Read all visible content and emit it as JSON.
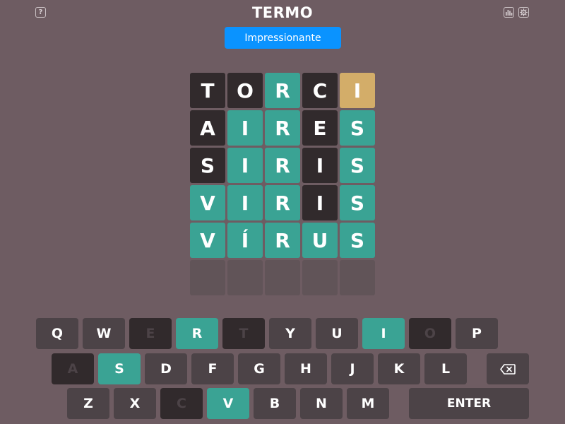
{
  "header": {
    "title": "TERMO",
    "help_label": "?",
    "icons": [
      "question-icon",
      "stats-chart-icon",
      "gear-icon"
    ]
  },
  "toast": {
    "message": "Impressionante"
  },
  "colors": {
    "background": "#6e5c62",
    "correct": "#3aa394",
    "present": "#d3ad69",
    "absent": "#312a2c",
    "empty": "#615458",
    "key": "#4c4347",
    "toast": "#0a93ff"
  },
  "board": {
    "rows": [
      {
        "letters": [
          "T",
          "O",
          "R",
          "C",
          "I"
        ],
        "states": [
          "absent",
          "absent",
          "correct",
          "absent",
          "present"
        ]
      },
      {
        "letters": [
          "A",
          "I",
          "R",
          "E",
          "S"
        ],
        "states": [
          "absent",
          "correct",
          "correct",
          "absent",
          "correct"
        ]
      },
      {
        "letters": [
          "S",
          "I",
          "R",
          "I",
          "S"
        ],
        "states": [
          "absent",
          "correct",
          "correct",
          "absent",
          "correct"
        ]
      },
      {
        "letters": [
          "V",
          "I",
          "R",
          "I",
          "S"
        ],
        "states": [
          "correct",
          "correct",
          "correct",
          "absent",
          "correct"
        ]
      },
      {
        "letters": [
          "V",
          "Í",
          "R",
          "U",
          "S"
        ],
        "states": [
          "correct",
          "correct",
          "correct",
          "correct",
          "correct"
        ]
      },
      {
        "letters": [
          "",
          "",
          "",
          "",
          ""
        ],
        "states": [
          "empty",
          "empty",
          "empty",
          "empty",
          "empty"
        ]
      }
    ]
  },
  "keyboard": {
    "rows": [
      [
        {
          "label": "Q",
          "state": "normal"
        },
        {
          "label": "W",
          "state": "normal"
        },
        {
          "label": "E",
          "state": "absent"
        },
        {
          "label": "R",
          "state": "correct"
        },
        {
          "label": "T",
          "state": "absent"
        },
        {
          "label": "Y",
          "state": "normal"
        },
        {
          "label": "U",
          "state": "normal"
        },
        {
          "label": "I",
          "state": "correct"
        },
        {
          "label": "O",
          "state": "absent"
        },
        {
          "label": "P",
          "state": "normal"
        }
      ],
      [
        {
          "label": "A",
          "state": "absent"
        },
        {
          "label": "S",
          "state": "correct"
        },
        {
          "label": "D",
          "state": "normal"
        },
        {
          "label": "F",
          "state": "normal"
        },
        {
          "label": "G",
          "state": "normal"
        },
        {
          "label": "H",
          "state": "normal"
        },
        {
          "label": "J",
          "state": "normal"
        },
        {
          "label": "K",
          "state": "normal"
        },
        {
          "label": "L",
          "state": "normal"
        },
        {
          "label": "⌫",
          "state": "normal",
          "icon": "backspace-icon"
        }
      ],
      [
        {
          "label": "Z",
          "state": "normal"
        },
        {
          "label": "X",
          "state": "normal"
        },
        {
          "label": "C",
          "state": "absent"
        },
        {
          "label": "V",
          "state": "correct"
        },
        {
          "label": "B",
          "state": "normal"
        },
        {
          "label": "N",
          "state": "normal"
        },
        {
          "label": "M",
          "state": "normal"
        },
        {
          "label": "ENTER",
          "state": "normal"
        }
      ]
    ]
  }
}
